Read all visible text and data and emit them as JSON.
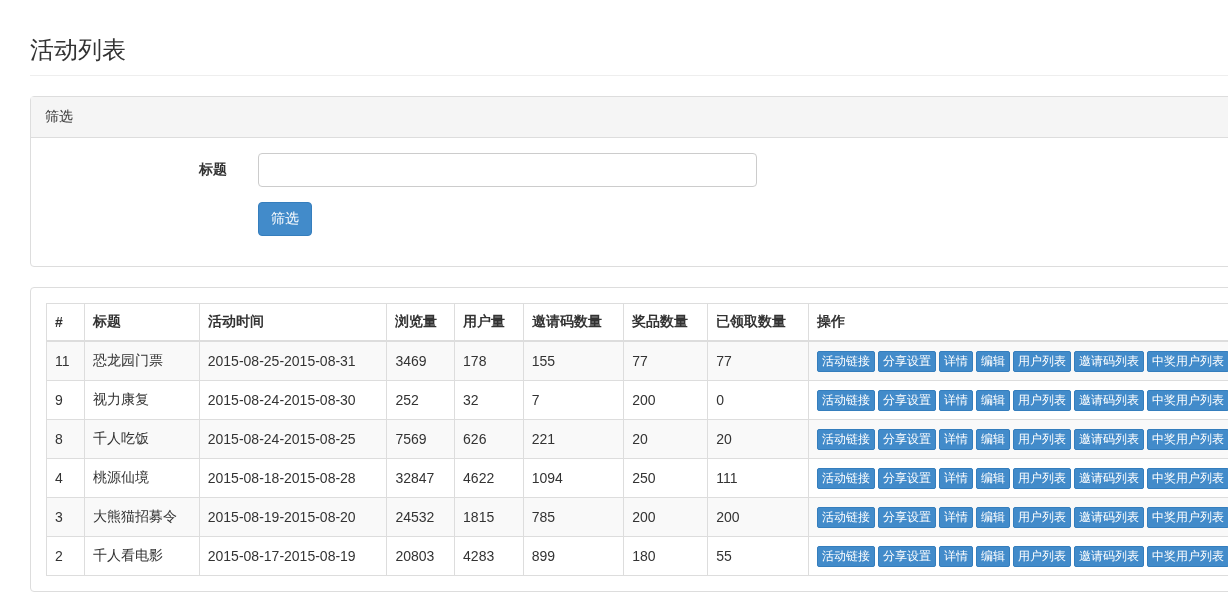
{
  "title": "活动列表",
  "filter": {
    "heading": "筛选",
    "field_label": "标题",
    "button": "筛选"
  },
  "table": {
    "columns": [
      "#",
      "标题",
      "活动时间",
      "浏览量",
      "用户量",
      "邀请码数量",
      "奖品数量",
      "已领取数量",
      "操作"
    ],
    "rows": [
      {
        "cells": [
          "11",
          "恐龙园门票",
          "2015-08-25-2015-08-31",
          "3469",
          "178",
          "155",
          "77",
          "77"
        ],
        "actions": [
          "活动链接",
          "分享设置",
          "详情",
          "编辑",
          "用户列表",
          "邀请码列表",
          "中奖用户列表"
        ]
      },
      {
        "cells": [
          "9",
          "视力康复",
          "2015-08-24-2015-08-30",
          "252",
          "32",
          "7",
          "200",
          "0"
        ],
        "actions": [
          "活动链接",
          "分享设置",
          "详情",
          "编辑",
          "用户列表",
          "邀请码列表",
          "中奖用户列表"
        ]
      },
      {
        "cells": [
          "8",
          "千人吃饭",
          "2015-08-24-2015-08-25",
          "7569",
          "626",
          "221",
          "20",
          "20"
        ],
        "actions": [
          "活动链接",
          "分享设置",
          "详情",
          "编辑",
          "用户列表",
          "邀请码列表",
          "中奖用户列表"
        ]
      },
      {
        "cells": [
          "4",
          "桃源仙境",
          "2015-08-18-2015-08-28",
          "32847",
          "4622",
          "1094",
          "250",
          "111"
        ],
        "actions": [
          "活动链接",
          "分享设置",
          "详情",
          "编辑",
          "用户列表",
          "邀请码列表",
          "中奖用户列表"
        ]
      },
      {
        "cells": [
          "3",
          "大熊猫招募令",
          "2015-08-19-2015-08-20",
          "24532",
          "1815",
          "785",
          "200",
          "200"
        ],
        "actions": [
          "活动链接",
          "分享设置",
          "详情",
          "编辑",
          "用户列表",
          "邀请码列表",
          "中奖用户列表"
        ]
      },
      {
        "cells": [
          "2",
          "千人看电影",
          "2015-08-17-2015-08-19",
          "20803",
          "4283",
          "899",
          "180",
          "55"
        ],
        "actions": [
          "活动链接",
          "分享设置",
          "详情",
          "编辑",
          "用户列表",
          "邀请码列表",
          "中奖用户列表"
        ]
      }
    ]
  }
}
